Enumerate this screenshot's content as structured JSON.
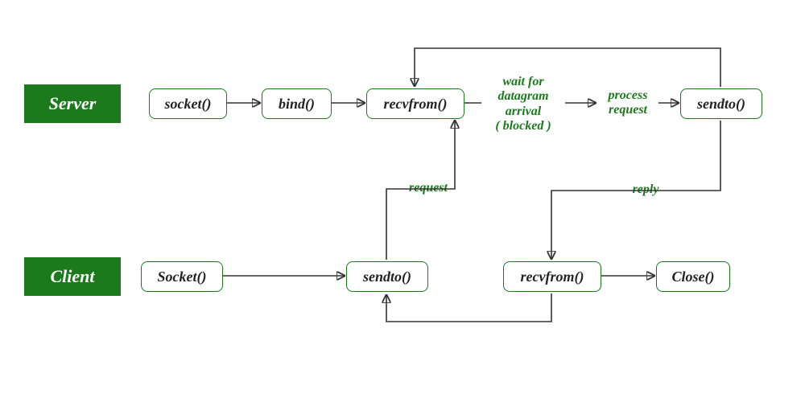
{
  "roles": {
    "server": "Server",
    "client": "Client"
  },
  "nodes": {
    "s_socket": "socket()",
    "s_bind": "bind()",
    "s_recvfrom": "recvfrom()",
    "s_sendto": "sendto()",
    "c_socket": "Socket()",
    "c_sendto": "sendto()",
    "c_recvfrom": "recvfrom()",
    "c_close": "Close()"
  },
  "labels": {
    "wait": "wait for\ndatagram\narrival\n( blocked )",
    "process": "process\nrequest",
    "request": "request",
    "reply": "reply"
  }
}
